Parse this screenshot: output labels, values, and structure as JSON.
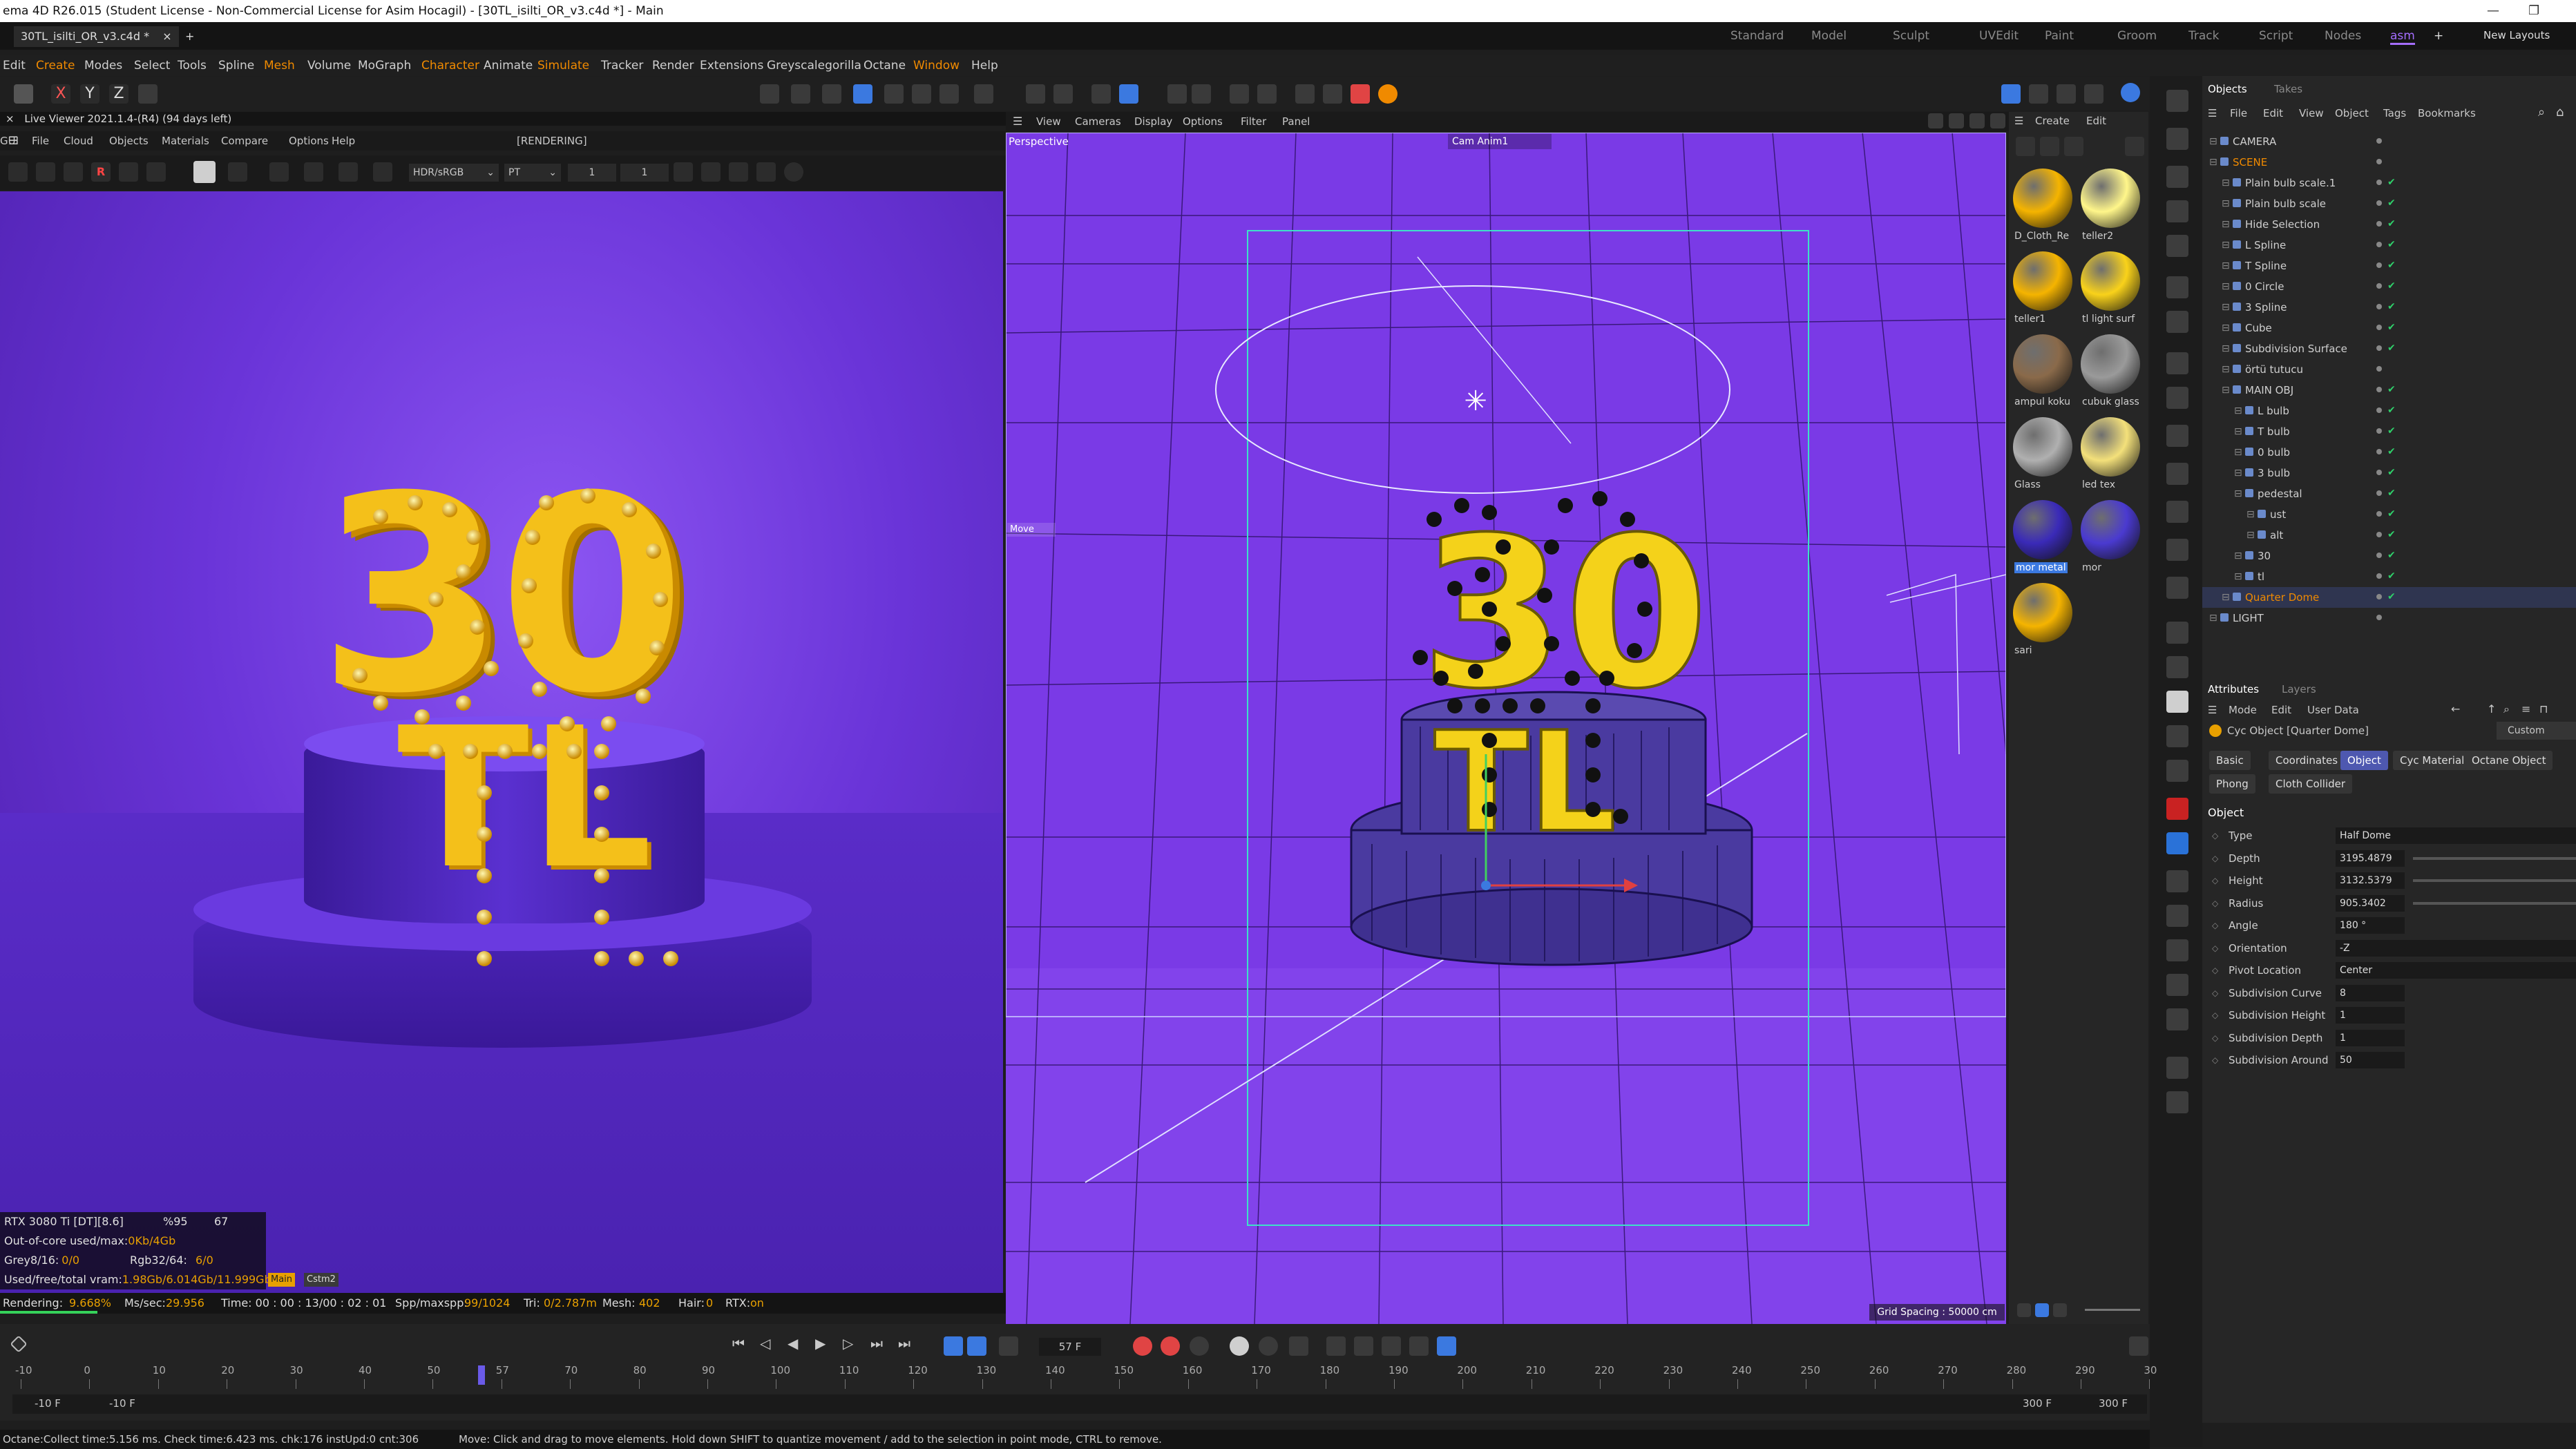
{
  "window": {
    "title": "ema 4D R26.015 (Student License - Non-Commercial License for Asim Hocagil) - [30TL_isilti_OR_v3.c4d *] - Main"
  },
  "tabs": {
    "doc": "30TL_isilti_OR_v3.c4d *",
    "close": "×",
    "add": "+"
  },
  "layouts": [
    "Standard",
    "Model",
    "Sculpt",
    "UVEdit",
    "Paint",
    "Groom",
    "Track",
    "Script",
    "Nodes",
    "asm"
  ],
  "new_layouts": "New Layouts",
  "menubar": [
    "Edit",
    "Create",
    "Modes",
    "Select",
    "Tools",
    "Spline",
    "Mesh",
    "Volume",
    "MoGraph",
    "Character",
    "Animate",
    "Simulate",
    "Tracker",
    "Render",
    "Extensions",
    "Greyscalegorilla",
    "Octane",
    "Window",
    "Help"
  ],
  "axis_locks": [
    "X",
    "Y",
    "Z"
  ],
  "liveviewer": {
    "header": "Live Viewer 2021.1.4-(R4) (94 days left)",
    "menu": [
      "File",
      "Cloud",
      "Objects",
      "Materials",
      "Compare",
      "Options",
      "Help",
      "GUI"
    ],
    "rendering": "[RENDERING]",
    "colorspace": "HDR/sRGB",
    "kernel": "PT",
    "fields": [
      "1",
      "1"
    ],
    "stats": {
      "gpu": "RTX 3080 Ti [DT][8.6]",
      "gpu_pct": "%95",
      "gpu_temp": "67",
      "ooc": "Out-of-core used/max:",
      "ooc_val": "0Kb/4Gb",
      "grey": "Grey8/16:",
      "grey_val": "0/0",
      "rgb": "Rgb32/64:",
      "rgb_val": "6/0",
      "vram": "Used/free/total vram:",
      "vram_val": "1.98Gb/6.014Gb/11.999Gb",
      "tag1": "Main",
      "tag2": "Cstm2"
    },
    "status": {
      "rendering": "Rendering:",
      "rendering_val": "9.668%",
      "mssec": "Ms/sec:",
      "mssec_val": "29.956",
      "time": "Time: 00 : 00 : 13/00 : 02 : 01",
      "spp": "Spp/maxspp:",
      "spp_val": "99/1024",
      "tri": "Tri:",
      "tri_val": "0/2.787m",
      "mesh": "Mesh:",
      "mesh_val": "402",
      "hair": "Hair:",
      "hair_val": "0",
      "rtx": "RTX:",
      "rtx_val": "on",
      "progress": 0.097
    }
  },
  "viewport": {
    "menu": [
      "View",
      "Cameras",
      "Display",
      "Options",
      "Filter",
      "Panel"
    ],
    "camera_label": "Perspective",
    "cam_name": "Cam Anim1",
    "move_label": "Move",
    "grid_spacing": "Grid Spacing : 50000 cm",
    "scene_text_top": "30",
    "scene_text_bottom": "TL"
  },
  "materials": {
    "menu": [
      "Create",
      "Edit"
    ],
    "items": [
      {
        "name": "D_Cloth_Re",
        "color": "#f5b400"
      },
      {
        "name": "teller2",
        "color": "#fff68a"
      },
      {
        "name": "teller1",
        "color": "#f5b400"
      },
      {
        "name": "tl light surf",
        "color": "#f9d21a"
      },
      {
        "name": "ampul koku",
        "color": "#8a6a4a"
      },
      {
        "name": "cubuk glass",
        "color": "#9a9a9a"
      },
      {
        "name": "Glass",
        "color": "#b0b0b0"
      },
      {
        "name": "led tex",
        "color": "#f3e07a"
      },
      {
        "name": "mor metal",
        "color": "#3a2ab8"
      },
      {
        "name": "mor",
        "color": "#4a3ad0"
      },
      {
        "name": "sari",
        "color": "#f5b400"
      }
    ]
  },
  "objects": {
    "tabs": [
      "Objects",
      "Takes"
    ],
    "menu": [
      "File",
      "Edit",
      "View",
      "Object",
      "Tags",
      "Bookmarks"
    ],
    "rows": [
      {
        "name": "CAMERA",
        "indent": 0,
        "color": "#cfcfcf"
      },
      {
        "name": "SCENE",
        "indent": 0,
        "color": "#f08a00"
      },
      {
        "name": "Plain bulb scale.1",
        "indent": 1,
        "color": "#cfcfcf"
      },
      {
        "name": "Plain bulb scale",
        "indent": 1,
        "color": "#cfcfcf"
      },
      {
        "name": "Hide Selection",
        "indent": 1,
        "color": "#cfcfcf"
      },
      {
        "name": "L Spline",
        "indent": 1,
        "color": "#cfcfcf"
      },
      {
        "name": "T Spline",
        "indent": 1,
        "color": "#cfcfcf"
      },
      {
        "name": "0 Circle",
        "indent": 1,
        "color": "#cfcfcf"
      },
      {
        "name": "3 Spline",
        "indent": 1,
        "color": "#cfcfcf"
      },
      {
        "name": "Cube",
        "indent": 1,
        "color": "#cfcfcf"
      },
      {
        "name": "Subdivision Surface",
        "indent": 1,
        "color": "#cfcfcf"
      },
      {
        "name": "örtü tutucu",
        "indent": 1,
        "color": "#cfcfcf"
      },
      {
        "name": "MAIN OBJ",
        "indent": 1,
        "color": "#cfcfcf"
      },
      {
        "name": "L bulb",
        "indent": 2,
        "color": "#cfcfcf"
      },
      {
        "name": "T bulb",
        "indent": 2,
        "color": "#cfcfcf"
      },
      {
        "name": "0 bulb",
        "indent": 2,
        "color": "#cfcfcf"
      },
      {
        "name": "3 bulb",
        "indent": 2,
        "color": "#cfcfcf"
      },
      {
        "name": "pedestal",
        "indent": 2,
        "color": "#cfcfcf"
      },
      {
        "name": "ust",
        "indent": 3,
        "color": "#cfcfcf"
      },
      {
        "name": "alt",
        "indent": 3,
        "color": "#cfcfcf"
      },
      {
        "name": "30",
        "indent": 2,
        "color": "#cfcfcf"
      },
      {
        "name": "tl",
        "indent": 2,
        "color": "#cfcfcf"
      },
      {
        "name": "Quarter Dome",
        "indent": 1,
        "color": "#f08a00"
      },
      {
        "name": "LIGHT",
        "indent": 0,
        "color": "#cfcfcf"
      }
    ]
  },
  "attributes": {
    "tabs": [
      "Attributes",
      "Layers"
    ],
    "menu": [
      "Mode",
      "Edit",
      "User Data"
    ],
    "object_title": "Cyc Object [Quarter Dome]",
    "custom": "Custom",
    "subtabs": [
      "Basic",
      "Coordinates",
      "Object",
      "Cyc Materials",
      "Octane Object"
    ],
    "subtabs2": [
      "Phong",
      "Cloth Collider"
    ],
    "section": "Object",
    "fields": [
      {
        "label": "Type",
        "value": "Half Dome"
      },
      {
        "label": "Depth",
        "value": "3195.4879"
      },
      {
        "label": "Height",
        "value": "3132.5379"
      },
      {
        "label": "Radius",
        "value": "905.3402"
      },
      {
        "label": "Angle",
        "value": "180 °"
      },
      {
        "label": "Orientation",
        "value": "-Z"
      },
      {
        "label": "Pivot Location",
        "value": "Center"
      },
      {
        "label": "Subdivision Curve",
        "value": "8"
      },
      {
        "label": "Subdivision Height",
        "value": "1"
      },
      {
        "label": "Subdivision Depth",
        "value": "1"
      },
      {
        "label": "Subdivision Around",
        "value": "50"
      }
    ]
  },
  "timeline": {
    "frame": "57 F",
    "ticks": [
      "-10",
      "0",
      "10",
      "20",
      "30",
      "40",
      "50",
      "57",
      "70",
      "80",
      "90",
      "100",
      "110",
      "120",
      "130",
      "140",
      "150",
      "160",
      "170",
      "180",
      "190",
      "200",
      "210",
      "220",
      "230",
      "240",
      "250",
      "260",
      "270",
      "280",
      "290",
      "30"
    ],
    "start_a": "-10 F",
    "start_b": "-10 F",
    "end_a": "300 F",
    "end_b": "300 F"
  },
  "status": {
    "left": "Octane:Collect time:5.156 ms.  Check time:6.423 ms.  chk:176  instUpd:0  cnt:306",
    "right": "Move: Click and drag to move elements. Hold down SHIFT to quantize movement / add to the selection in point mode, CTRL to remove."
  }
}
